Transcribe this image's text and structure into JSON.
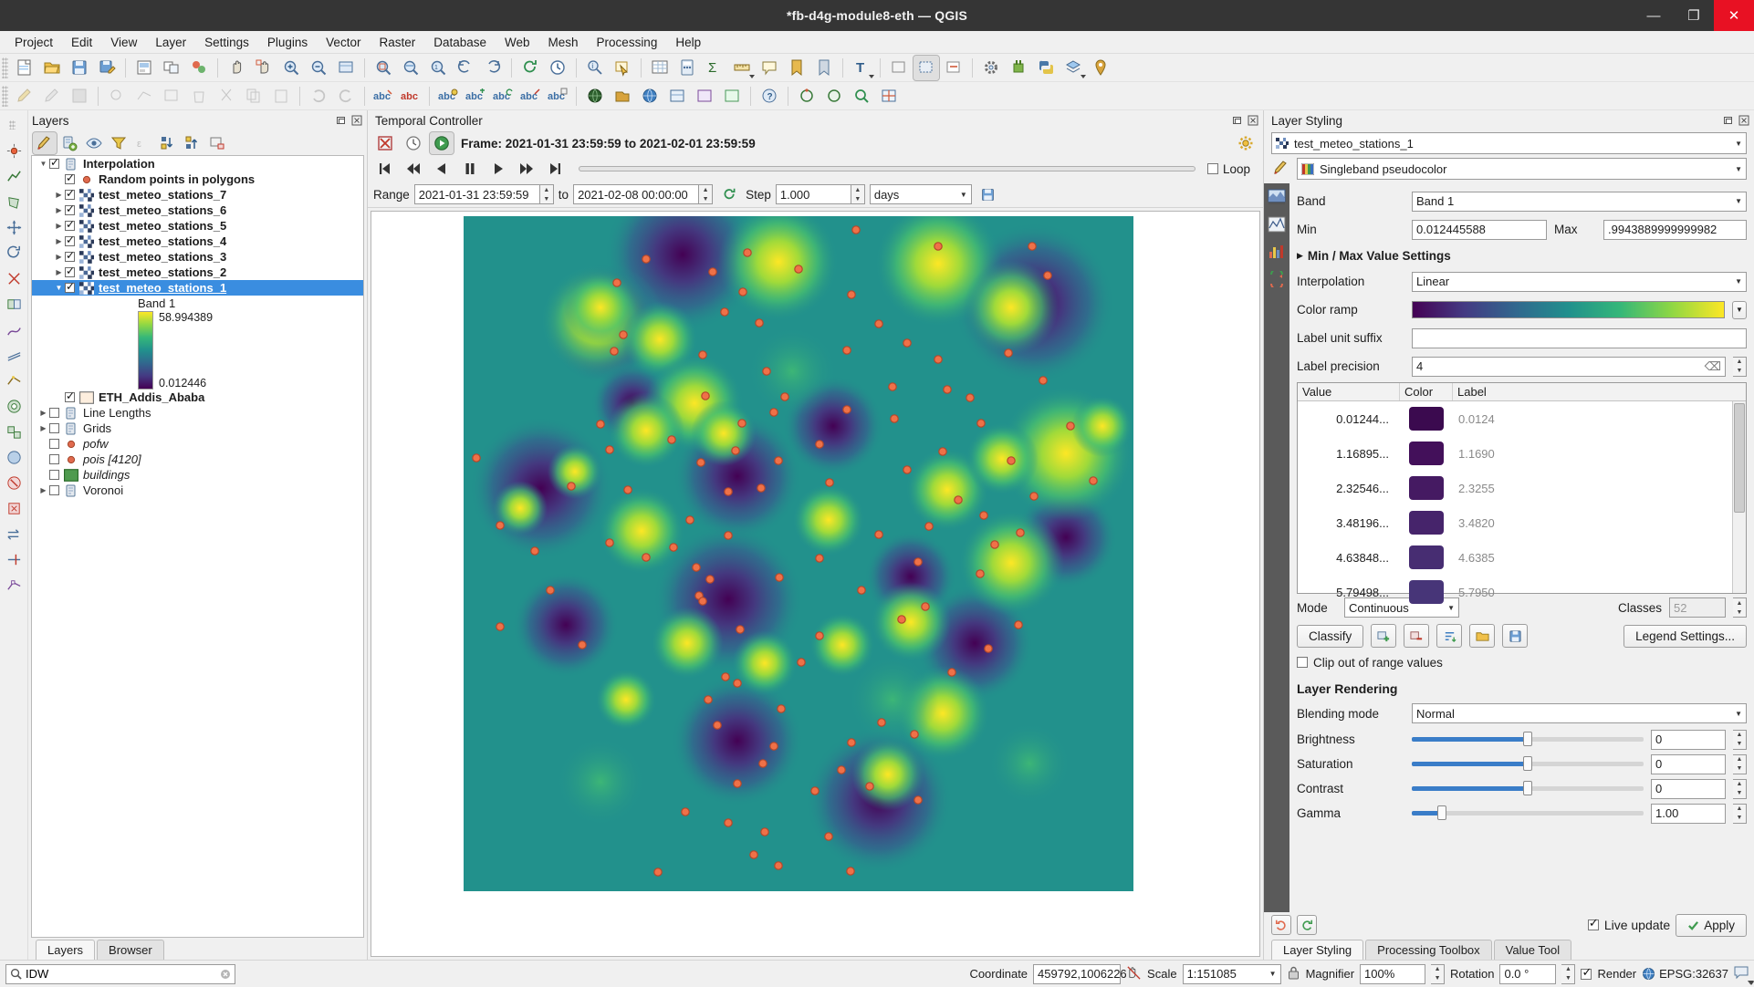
{
  "window": {
    "title": "*fb-d4g-module8-eth — QGIS",
    "minimize": "—",
    "maximize": "❐",
    "close": "✕"
  },
  "menubar": [
    "Project",
    "Edit",
    "View",
    "Layer",
    "Settings",
    "Plugins",
    "Vector",
    "Raster",
    "Database",
    "Web",
    "Mesh",
    "Processing",
    "Help"
  ],
  "layers_panel": {
    "title": "Layers",
    "toolbar": [
      "open-styling-panel-icon",
      "add-group-icon",
      "manage-visibility-icon",
      "filter-legend-icon",
      "expression-filter-icon",
      "expand-all-icon",
      "collapse-all-icon",
      "remove-layer-icon"
    ],
    "tree": [
      {
        "name": "Interpolation",
        "indent": 0,
        "checked": true,
        "expanded": true,
        "arrow": "down",
        "icon": "group-icon",
        "style": "bold",
        "selected": false
      },
      {
        "name": "Random points in polygons",
        "indent": 1,
        "checked": true,
        "arrow": "",
        "icon": "point-layer-icon",
        "style": "bold",
        "selected": false
      },
      {
        "name": "test_meteo_stations_7",
        "indent": 1,
        "checked": true,
        "arrow": "right",
        "icon": "raster-layer-icon",
        "style": "bold",
        "selected": false
      },
      {
        "name": "test_meteo_stations_6",
        "indent": 1,
        "checked": true,
        "arrow": "right",
        "icon": "raster-layer-icon",
        "style": "bold",
        "selected": false
      },
      {
        "name": "test_meteo_stations_5",
        "indent": 1,
        "checked": true,
        "arrow": "right",
        "icon": "raster-layer-icon",
        "style": "bold",
        "selected": false
      },
      {
        "name": "test_meteo_stations_4",
        "indent": 1,
        "checked": true,
        "arrow": "right",
        "icon": "raster-layer-icon",
        "style": "bold",
        "selected": false
      },
      {
        "name": "test_meteo_stations_3",
        "indent": 1,
        "checked": true,
        "arrow": "right",
        "icon": "raster-layer-icon",
        "style": "bold",
        "selected": false
      },
      {
        "name": "test_meteo_stations_2",
        "indent": 1,
        "checked": true,
        "arrow": "right",
        "icon": "raster-layer-icon",
        "style": "bold",
        "selected": false
      },
      {
        "name": "test_meteo_stations_1",
        "indent": 1,
        "checked": true,
        "arrow": "down",
        "icon": "raster-layer-icon",
        "style": "bold",
        "selected": true
      }
    ],
    "band_label": "Band 1",
    "ramp_max": "58.994389",
    "ramp_min": "0.012446",
    "tree_after": [
      {
        "name": "ETH_Addis_Ababa",
        "indent": 1,
        "checked": true,
        "arrow": "",
        "icon": "polygon-swatch-icon",
        "style": "bold",
        "selected": false
      },
      {
        "name": "Line Lengths",
        "indent": 0,
        "checked": false,
        "arrow": "right",
        "icon": "group-icon",
        "style": "plain",
        "selected": false
      },
      {
        "name": "Grids",
        "indent": 0,
        "checked": false,
        "arrow": "right",
        "icon": "group-icon",
        "style": "plain",
        "selected": false
      },
      {
        "name": "pofw",
        "indent": 0,
        "checked": false,
        "arrow": "",
        "icon": "point-layer-icon",
        "style": "italic",
        "selected": false
      },
      {
        "name": "pois [4120]",
        "indent": 0,
        "checked": false,
        "arrow": "",
        "icon": "point-layer-icon",
        "style": "italic",
        "selected": false
      },
      {
        "name": "buildings",
        "indent": 0,
        "checked": false,
        "arrow": "",
        "icon": "polygon-layer-icon",
        "style": "italic",
        "selected": false
      },
      {
        "name": "Voronoi",
        "indent": 0,
        "checked": false,
        "arrow": "right",
        "icon": "group-icon",
        "style": "plain",
        "selected": false
      }
    ],
    "tabs": [
      {
        "label": "Layers",
        "active": true
      },
      {
        "label": "Browser",
        "active": false
      }
    ]
  },
  "temporal_controller": {
    "title": "Temporal Controller",
    "frame_text": "Frame: 2021-01-31 23:59:59 to 2021-02-01 23:59:59",
    "loop_label": "Loop",
    "loop_checked": false,
    "range_label": "Range",
    "range_start": "2021-01-31 23:59:59",
    "to_label": "to",
    "range_end": "2021-02-08 00:00:00",
    "step_label": "Step",
    "step_value": "1.000",
    "step_unit": "days",
    "transport": [
      "skip-first-icon",
      "rewind-icon",
      "step-back-icon",
      "pause-icon",
      "play-icon",
      "step-forward-icon",
      "skip-last-icon"
    ]
  },
  "layer_styling": {
    "title": "Layer Styling",
    "layer_name": "test_meteo_stations_1",
    "renderer": "Singleband pseudocolor",
    "band_label": "Band",
    "band_value": "Band 1",
    "min_label": "Min",
    "min_value": "0.012445588",
    "max_label": "Max",
    "max_value": ".9943889999999982",
    "minmax_settings": "Min / Max Value Settings",
    "interpolation_label": "Interpolation",
    "interpolation_value": "Linear",
    "colorramp_label": "Color ramp",
    "label_unit_suffix_label": "Label unit suffix",
    "label_unit_suffix_value": "",
    "label_precision_label": "Label precision",
    "label_precision_value": "4",
    "table_headers": [
      "Value",
      "Color",
      "Label"
    ],
    "table_rows": [
      {
        "value": "0.01244...",
        "color": "#3b0a4f",
        "label": "0.0124"
      },
      {
        "value": "1.16895...",
        "color": "#43105a",
        "label": "1.1690"
      },
      {
        "value": "2.32546...",
        "color": "#451a62",
        "label": "2.3255"
      },
      {
        "value": "3.48196...",
        "color": "#46246b",
        "label": "3.4820"
      },
      {
        "value": "4.63848...",
        "color": "#472d72",
        "label": "4.6385"
      },
      {
        "value": "5.79498...",
        "color": "#473578",
        "label": "5.7950"
      }
    ],
    "mode_label": "Mode",
    "mode_value": "Continuous",
    "classes_label": "Classes",
    "classes_value": "52",
    "classify_button": "Classify",
    "legend_settings_button": "Legend Settings...",
    "table_buttons": [
      "add-entry-icon",
      "remove-entry-icon",
      "sort-entries-icon",
      "load-ramp-icon",
      "save-ramp-icon"
    ],
    "clip_label": "Clip out of range values",
    "clip_checked": false,
    "rendering_header": "Layer Rendering",
    "blending_label": "Blending mode",
    "blending_value": "Normal",
    "brightness_label": "Brightness",
    "brightness_value": "0",
    "saturation_label": "Saturation",
    "saturation_value": "0",
    "contrast_label": "Contrast",
    "contrast_value": "0",
    "gamma_label": "Gamma",
    "gamma_value": "1.00",
    "live_update_label": "Live update",
    "live_update_checked": true,
    "apply_button": "Apply",
    "tabs": [
      {
        "label": "Layer Styling",
        "active": true
      },
      {
        "label": "Processing Toolbox",
        "active": false
      },
      {
        "label": "Value Tool",
        "active": false
      }
    ]
  },
  "statusbar": {
    "search_value": "IDW",
    "coordinate_label": "Coordinate",
    "coordinate_value": "459792,1006226",
    "scale_label": "Scale",
    "scale_value": "1:151085",
    "magnifier_label": "Magnifier",
    "magnifier_value": "100%",
    "rotation_label": "Rotation",
    "rotation_value": "0.0 °",
    "render_label": "Render",
    "render_checked": true,
    "epsg_value": "EPSG:32637"
  },
  "colors": {
    "titlebar_bg": "#353535",
    "selection_blue": "#3a8de0",
    "close_red": "#e81123",
    "viridis_min": "#440154",
    "viridis_max": "#fde725",
    "point_marker": "#e8613c"
  },
  "map": {
    "description": "Interpolated IDW raster with viridis color ramp and orange sample point markers"
  }
}
